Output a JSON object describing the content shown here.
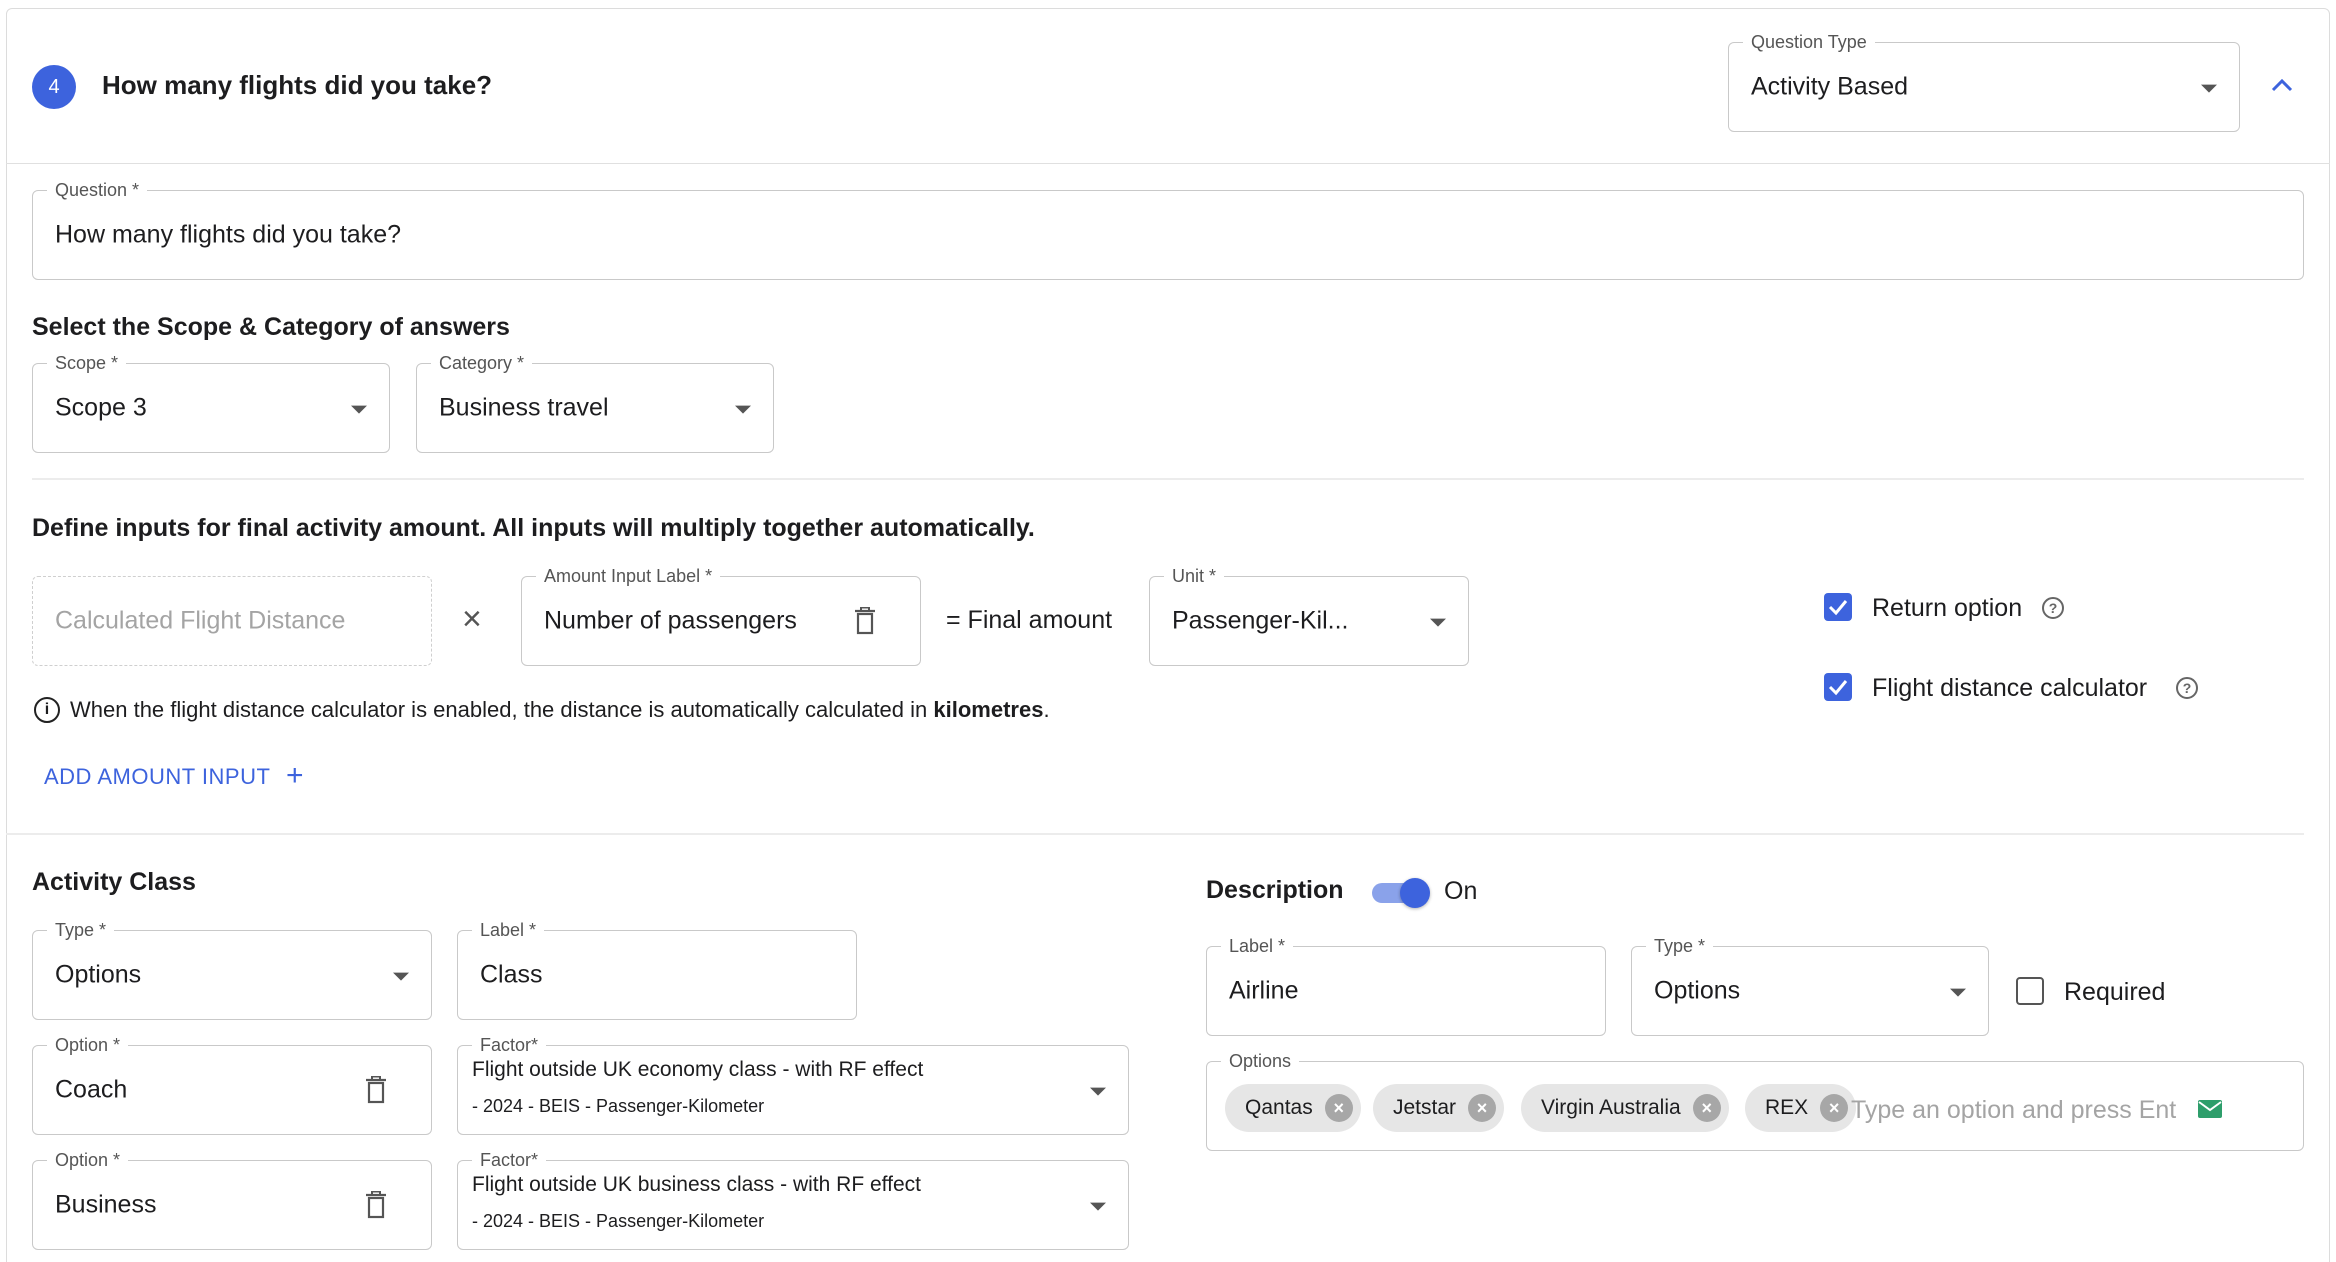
{
  "header": {
    "step_number": "4",
    "title": "How many flights did you take?",
    "question_type": {
      "label": "Question Type",
      "value": "Activity Based"
    }
  },
  "question": {
    "label": "Question *",
    "value": "How many flights did you take?"
  },
  "scope_section": {
    "title": "Select the Scope & Category of answers",
    "scope": {
      "label": "Scope *",
      "value": "Scope 3"
    },
    "category": {
      "label": "Category *",
      "value": "Business travel"
    }
  },
  "inputs_section": {
    "title": "Define inputs for final activity amount. All inputs will multiply together automatically.",
    "calculated_placeholder": "Calculated Flight Distance",
    "multiply_symbol": "×",
    "amount_input": {
      "label": "Amount Input Label *",
      "value": "Number of passengers"
    },
    "equals_text": "=  Final amount",
    "unit": {
      "label": "Unit *",
      "value": "Passenger-Kil..."
    },
    "return_option": {
      "label": "Return option",
      "checked": true
    },
    "flight_calc": {
      "label": "Flight distance calculator",
      "checked": true
    },
    "info_text_pre": "When the flight distance calculator is enabled, the distance is automatically calculated in ",
    "info_text_bold": "kilometres",
    "info_text_post": ".",
    "add_amount_label": "ADD AMOUNT INPUT",
    "add_icon": "+"
  },
  "activity_class": {
    "title": "Activity Class",
    "type": {
      "label": "Type *",
      "value": "Options"
    },
    "label": {
      "label": "Label *",
      "value": "Class"
    },
    "options": [
      {
        "option_label": "Option *",
        "value": "Coach",
        "factor_label": "Factor*",
        "factor_name": "Flight outside UK economy class - with RF effect",
        "factor_meta": "- 2024 - BEIS - Passenger-Kilometer"
      },
      {
        "option_label": "Option *",
        "value": "Business",
        "factor_label": "Factor*",
        "factor_name": "Flight outside UK business class - with RF effect",
        "factor_meta": "- 2024 - BEIS - Passenger-Kilometer"
      }
    ]
  },
  "description": {
    "title": "Description",
    "toggle_state": "On",
    "label": {
      "label": "Label *",
      "value": "Airline"
    },
    "type": {
      "label": "Type *",
      "value": "Options"
    },
    "required_label": "Required",
    "options_label": "Options",
    "chips": [
      "Qantas",
      "Jetstar",
      "Virgin Australia",
      "REX"
    ],
    "chip_remove_icon": "×",
    "chips_placeholder": "Type an option and press Ent"
  },
  "icons": {
    "collapse": "chevron-up-icon",
    "trash": "trash-icon",
    "info": "info-icon",
    "help": "help-circle-icon",
    "email": "email-icon"
  },
  "colors": {
    "accent": "#3d63dd",
    "border": "#c9c9c9",
    "chip_bg": "#e6e6e6"
  }
}
